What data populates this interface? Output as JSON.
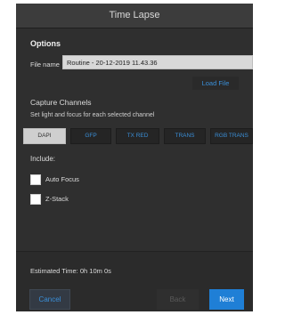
{
  "dialog": {
    "title": "Time Lapse",
    "options_title": "Options",
    "file_name_label": "File name",
    "file_name_value": "Routine - 20-12-2019 11.43.36",
    "load_file_label": "Load File",
    "capture_title": "Capture Channels",
    "capture_subtitle": "Set light and focus for each selected channel",
    "channels": [
      {
        "label": "DAPI",
        "selected": true
      },
      {
        "label": "GFP",
        "selected": false
      },
      {
        "label": "TX RED",
        "selected": false
      },
      {
        "label": "TRANS",
        "selected": false
      },
      {
        "label": "RGB TRANS",
        "selected": false
      }
    ],
    "include_label": "Include:",
    "auto_focus_label": "Auto Focus",
    "z_stack_label": "Z-Stack",
    "estimated_time": "Estimated Time: 0h 10m 0s",
    "cancel_label": "Cancel",
    "back_label": "Back",
    "next_label": "Next"
  },
  "colors": {
    "accent": "#3a8fd8",
    "primary_button": "#1f7fd6",
    "background": "#2d2d2d"
  }
}
